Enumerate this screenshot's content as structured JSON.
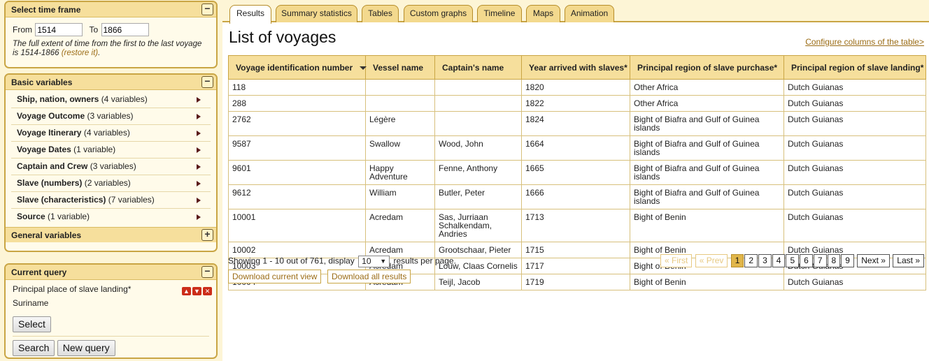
{
  "sidebar": {
    "time_frame": {
      "title": "Select time frame",
      "from_label": "From",
      "from_value": "1514",
      "to_label": "To",
      "to_value": "1866",
      "note": "The full extent of time from the first to the last voyage is 1514-1866",
      "restore_link": "(restore it)",
      "note_end": "."
    },
    "basic_variables": {
      "title": "Basic variables",
      "items": [
        {
          "label": "Ship, nation, owners",
          "count": "(4 variables)"
        },
        {
          "label": "Voyage Outcome",
          "count": "(3 variables)"
        },
        {
          "label": "Voyage Itinerary",
          "count": "(4 variables)"
        },
        {
          "label": "Voyage Dates",
          "count": "(1 variable)"
        },
        {
          "label": "Captain and Crew",
          "count": "(3 variables)"
        },
        {
          "label": "Slave (numbers)",
          "count": "(2 variables)"
        },
        {
          "label": "Slave (characteristics)",
          "count": "(7 variables)"
        },
        {
          "label": "Source",
          "count": "(1 variable)"
        }
      ]
    },
    "general_variables": {
      "title": "General variables"
    },
    "current_query": {
      "title": "Current query",
      "label": "Principal place of slave landing*",
      "value": "Suriname",
      "select_button": "Select",
      "search_button": "Search",
      "new_query_button": "New query"
    }
  },
  "tabs": [
    {
      "label": "Results",
      "active": true
    },
    {
      "label": "Summary statistics"
    },
    {
      "label": "Tables"
    },
    {
      "label": "Custom graphs"
    },
    {
      "label": "Timeline"
    },
    {
      "label": "Maps"
    },
    {
      "label": "Animation"
    }
  ],
  "main": {
    "title": "List of voyages",
    "configure_link": "Configure columns of the table>",
    "columns": [
      "Voyage identification number",
      "Vessel name",
      "Captain's name",
      "Year arrived with slaves*",
      "Principal region of slave purchase*",
      "Principal region of slave landing*"
    ],
    "rows": [
      [
        "118",
        "",
        "",
        "1820",
        "Other Africa",
        "Dutch Guianas"
      ],
      [
        "288",
        "",
        "",
        "1822",
        "Other Africa",
        "Dutch Guianas"
      ],
      [
        "2762",
        "Légère",
        "",
        "1824",
        "Bight of Biafra and Gulf of Guinea islands",
        "Dutch Guianas"
      ],
      [
        "9587",
        "Swallow",
        "Wood, John",
        "1664",
        "Bight of Biafra and Gulf of Guinea islands",
        "Dutch Guianas"
      ],
      [
        "9601",
        "Happy Adventure",
        "Fenne, Anthony",
        "1665",
        "Bight of Biafra and Gulf of Guinea islands",
        "Dutch Guianas"
      ],
      [
        "9612",
        "William",
        "Butler, Peter",
        "1666",
        "Bight of Biafra and Gulf of Guinea islands",
        "Dutch Guianas"
      ],
      [
        "10001",
        "Acredam",
        "Sas, Jurriaan\nSchalkendam, Andries",
        "1713",
        "Bight of Benin",
        "Dutch Guianas"
      ],
      [
        "10002",
        "Acredam",
        "Grootschaar, Pieter",
        "1715",
        "Bight of Benin",
        "Dutch Guianas"
      ],
      [
        "10003",
        "Acredam",
        "Louw, Claas Cornelis",
        "1717",
        "Bight of Benin",
        "Dutch Guianas"
      ],
      [
        "10004",
        "Acredam",
        "Teijl, Jacob",
        "1719",
        "Bight of Benin",
        "Dutch Guianas"
      ]
    ],
    "pager_info_prefix": "Showing 1 - 10 out of 761, display",
    "per_page_value": "10",
    "pager_info_suffix": "results per page.",
    "pager": {
      "first": "« First",
      "prev": "« Prev",
      "pages": [
        "1",
        "2",
        "3",
        "4",
        "5",
        "6",
        "7",
        "8",
        "9"
      ],
      "current": "1",
      "next": "Next »",
      "last": "Last »"
    },
    "download_current": "Download current view",
    "download_all": "Download all results"
  }
}
